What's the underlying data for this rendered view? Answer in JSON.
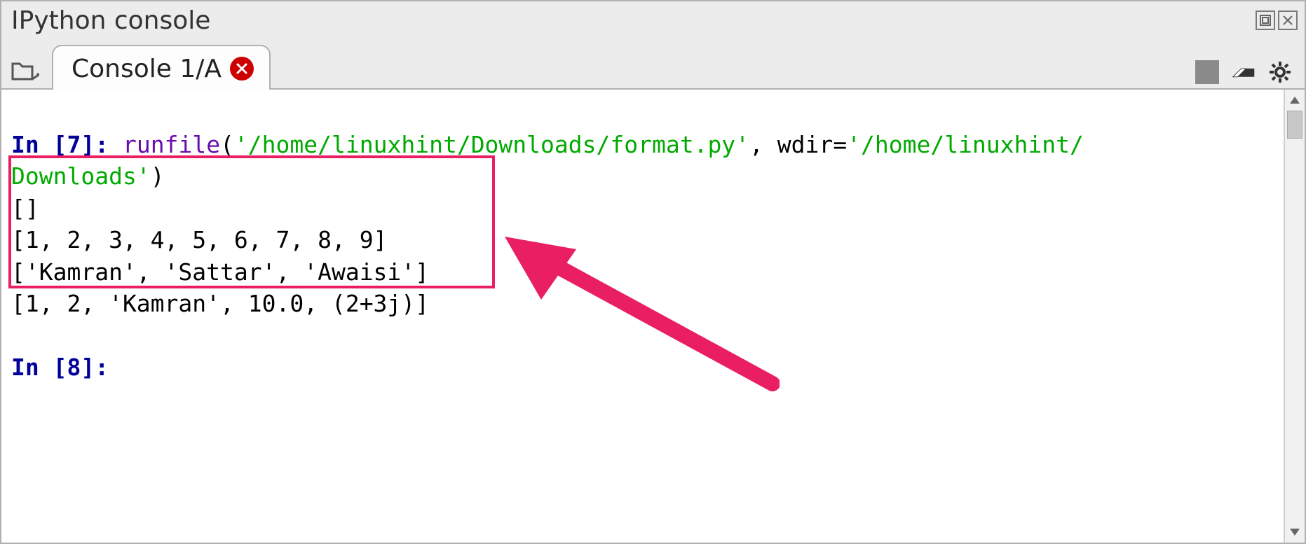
{
  "pane": {
    "title": "IPython console"
  },
  "tab": {
    "label": "Console 1/A"
  },
  "console": {
    "prompt1_prefix": "In [",
    "prompt1_num": "7",
    "prompt1_suffix": "]:",
    "cmd_runfile": "runfile",
    "cmd_open": "(",
    "cmd_path1": "'/home/linuxhint/Downloads/format.py'",
    "cmd_sep": ", wdir=",
    "cmd_path2a": "'/home/linuxhint/",
    "cmd_path2b": "Downloads'",
    "cmd_close": ")",
    "out_line1": "[]",
    "out_line2": "[1, 2, 3, 4, 5, 6, 7, 8, 9]",
    "out_line3": "['Kamran', 'Sattar', 'Awaisi']",
    "out_line4": "[1, 2, 'Kamran', 10.0, (2+3j)]",
    "prompt2_prefix": "In [",
    "prompt2_num": "8",
    "prompt2_suffix": "]:"
  }
}
